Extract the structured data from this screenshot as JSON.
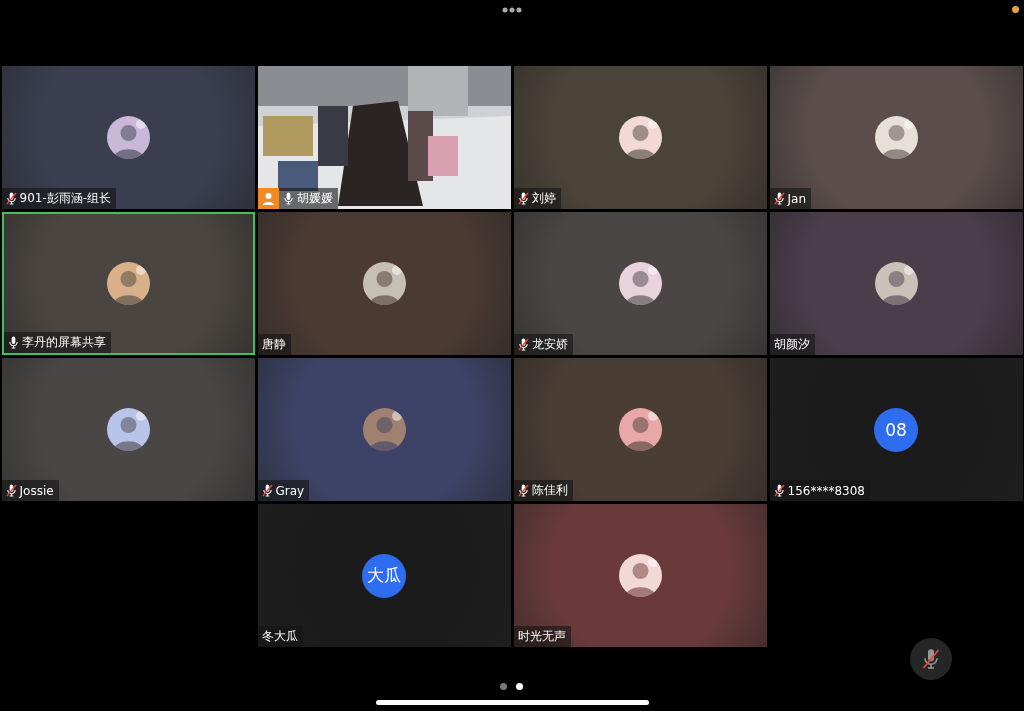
{
  "tiles": [
    {
      "name": "901-彭雨涵-组长",
      "mic": {
        "muted": true
      },
      "host": false,
      "speaking": false,
      "color": "#3b3e50"
    },
    {
      "name": "胡媛媛",
      "mic": {
        "muted": false
      },
      "host": true,
      "speaking": false,
      "avatar": {
        "kind": "video"
      }
    },
    {
      "name": "刘婷",
      "mic": {
        "muted": true
      },
      "host": false,
      "speaking": false,
      "color": "#4a4338"
    },
    {
      "name": "Jan",
      "mic": {
        "muted": true
      },
      "host": false,
      "speaking": false,
      "color": "#5a4d4c"
    },
    {
      "name": "李丹的屏幕共享",
      "mic": {
        "muted": false
      },
      "host": false,
      "speaking": true,
      "color": "#4a4540"
    },
    {
      "name": "唐静",
      "host": false,
      "speaking": false,
      "color": "#4a3a32"
    },
    {
      "name": "龙安娇",
      "mic": {
        "muted": true
      },
      "host": false,
      "speaking": false,
      "color": "#4a4646"
    },
    {
      "name": "胡颜汐",
      "host": false,
      "speaking": false,
      "color": "#4a3e4a"
    },
    {
      "name": "Jossie",
      "mic": {
        "muted": true
      },
      "host": false,
      "speaking": false,
      "color": "#4a4646"
    },
    {
      "name": "Gray",
      "mic": {
        "muted": true
      },
      "host": false,
      "speaking": false,
      "color": "#3c4366"
    },
    {
      "name": "陈佳利",
      "mic": {
        "muted": true
      },
      "host": false,
      "speaking": false,
      "color": "#4a3d34"
    },
    {
      "name": "156****8308",
      "mic": {
        "muted": true
      },
      "host": false,
      "speaking": false,
      "avatar": {
        "kind": "initials",
        "text": "08"
      },
      "color": "#1b1b1b"
    },
    {
      "name": "冬大瓜",
      "host": false,
      "speaking": false,
      "avatar": {
        "kind": "initials",
        "text": "大瓜"
      },
      "color": "#1b1b1b"
    },
    {
      "name": "时光无声",
      "host": false,
      "speaking": false,
      "color": "#6a3a3a"
    }
  ],
  "pages": [
    {
      "selected": false
    },
    {
      "selected": true
    }
  ],
  "mute_button": {
    "muted": true
  }
}
